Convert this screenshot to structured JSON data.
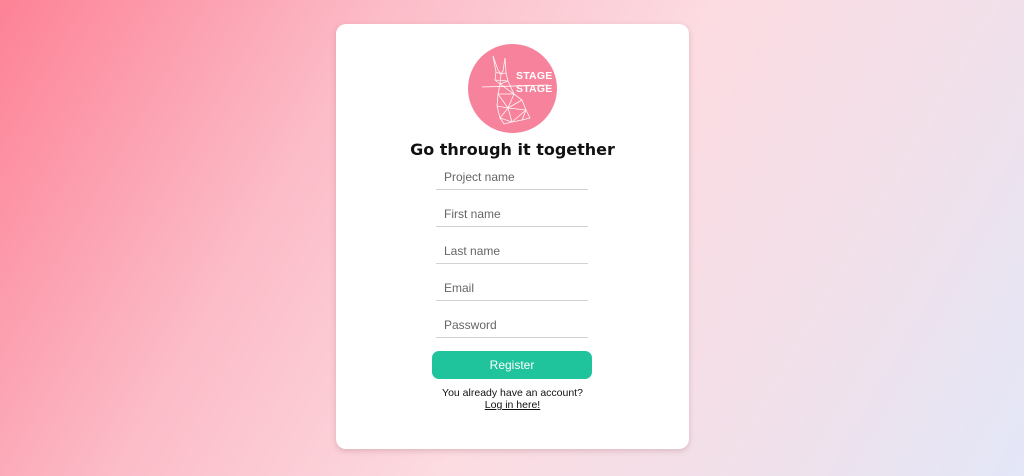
{
  "logo": {
    "line1": "STAGE",
    "line2": "STAGE",
    "icon": "geometric-rabbit-icon",
    "color": "#f7829b"
  },
  "title": "Go through it together",
  "form": {
    "fields": [
      {
        "name": "project-name",
        "placeholder": "Project name",
        "value": ""
      },
      {
        "name": "first-name",
        "placeholder": "First name",
        "value": ""
      },
      {
        "name": "last-name",
        "placeholder": "Last name",
        "value": ""
      },
      {
        "name": "email",
        "placeholder": "Email",
        "value": ""
      },
      {
        "name": "password",
        "placeholder": "Password",
        "value": ""
      }
    ],
    "register_label": "Register",
    "register_color": "#1fc39c"
  },
  "footer": {
    "account_text": "You already have an account?",
    "login_label": "Log in here!"
  }
}
